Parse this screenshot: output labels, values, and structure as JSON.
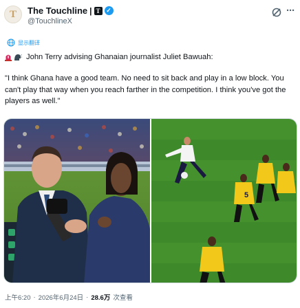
{
  "account": {
    "display_name": "The Touchline",
    "affiliation_sep": "|",
    "affiliation_badge": "T",
    "handle": "@TouchlineX",
    "avatar_letter": "T",
    "verified_color": "#1d9bf0"
  },
  "translate": {
    "label": "显示翻译"
  },
  "tweet": {
    "intro": "John Terry advising Ghanaian journalist Juliet Bawuah:",
    "quote": "\"I think Ghana have a good team. No need to sit back and play in a low block. You can't play that way when you reach farther in the competition. I think you've got the players as well.\""
  },
  "media": {
    "left": {
      "icon": "interview-photo"
    },
    "right": {
      "icon": "match-photo",
      "jersey_number": "5"
    }
  },
  "footer": {
    "time": "上午6:20",
    "date": "2026年6月24日",
    "views": "28.6万",
    "views_label": "次查看",
    "separator": "·"
  },
  "colors": {
    "accent": "#1d9bf0",
    "text": "#0f1419",
    "muted": "#536471"
  }
}
